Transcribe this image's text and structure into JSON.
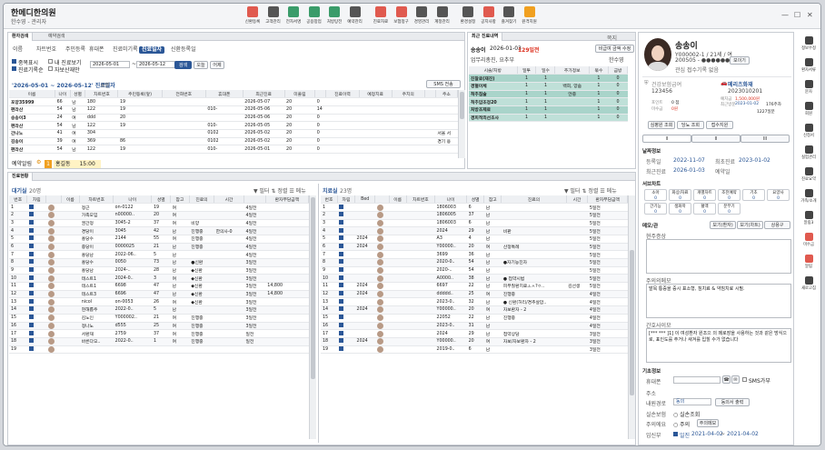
{
  "app": {
    "title": "한메디한의원",
    "subtitle": "한수영 - 관리자"
  },
  "toolbar": [
    {
      "label": "신환등록",
      "color": "#e05a4f"
    },
    {
      "label": "고객관리",
      "color": "#555"
    },
    {
      "label": "전자서명",
      "color": "#3a9c6a"
    },
    {
      "label": "공용창업",
      "color": "#3a9c6a"
    },
    {
      "label": "처방탕전",
      "color": "#3a9c6a"
    },
    {
      "label": "예약관리",
      "color": "#555"
    },
    {
      "label": "진료자료",
      "color": "#e05a4f"
    },
    {
      "label": "보험청구",
      "color": "#e05a4f"
    },
    {
      "label": "경영관리",
      "color": "#555"
    },
    {
      "label": "계정관리",
      "color": "#555"
    },
    {
      "label": "환경설정",
      "color": "#555"
    },
    {
      "label": "공지사항",
      "color": "#e05a4f"
    },
    {
      "label": "즐겨찾기",
      "color": "#555"
    },
    {
      "label": "원격지원",
      "color": "#f0a020"
    }
  ],
  "search_panel": {
    "tabs": [
      "환자검색",
      "예약검색"
    ],
    "subtabs": [
      "이름",
      "차트번호",
      "주민등록",
      "휴대폰",
      "진료미기록",
      "진료일자",
      "신환등록일"
    ],
    "active_subtab": "진료일자",
    "checks": [
      "중복표시",
      "진료기록순",
      "내 진료보기",
      "자보산재만"
    ],
    "date_from": "2026-05-01",
    "date_to": "2026-05-12",
    "btn_search": "검색",
    "btn_today": "오늘",
    "btn_yesterday": "어제",
    "result_title": "'2026-05-01 ~ 2026-05-12' 진료일자",
    "result_count": "8명",
    "sms": "SMS 전송",
    "columns": [
      "이름",
      "나이",
      "성별",
      "차트번호",
      "주민등록(앞)",
      "전화번호",
      "휴대폰",
      "최근진료",
      "미풀림",
      "",
      "진료이력",
      "예정치료",
      "주치의",
      "",
      "주소"
    ],
    "rows": [
      [
        "포양35999",
        "66",
        "남",
        "180",
        "19",
        "",
        "",
        "2026-05-07",
        "20",
        "0",
        "",
        "",
        "",
        "",
        ""
      ],
      [
        "편라산",
        "54",
        "남",
        "122",
        "19",
        "",
        "010-",
        "2026-05-06",
        "20",
        "14",
        "",
        "",
        "",
        "",
        ""
      ],
      [
        "송송이3",
        "24",
        "여",
        "ddd",
        "20",
        "",
        "",
        "2026-05-06",
        "20",
        "0",
        "",
        "",
        "",
        "",
        ""
      ],
      [
        "편라산",
        "54",
        "남",
        "122",
        "19",
        "",
        "010-",
        "2026-05-05",
        "20",
        "0",
        "",
        "",
        "",
        "",
        ""
      ],
      [
        "간나노",
        "41",
        "여",
        "304",
        "",
        "",
        "0102",
        "2026-05-02",
        "20",
        "0",
        "",
        "",
        "",
        "",
        "서울 서"
      ],
      [
        "김송이",
        "39",
        "여",
        "369",
        "86",
        "",
        "0102",
        "2026-05-02",
        "20",
        "0",
        "",
        "",
        "",
        "",
        "경기 용"
      ],
      [
        "편라산",
        "54",
        "남",
        "122",
        "19",
        "",
        "010-",
        "2026-05-01",
        "20",
        "0",
        "",
        "",
        "",
        "",
        ""
      ]
    ],
    "reservation_label": "예약알림",
    "reservation_badge": "1",
    "reservation_name": "홍길동",
    "reservation_time": "15:00"
  },
  "recent": {
    "title": "최근 진료내역",
    "close": "쪽지",
    "patient": "송송이",
    "date": "2026-01-03",
    "days_ago": "129일전",
    "btn_price": "비급여 금액 수정",
    "doctor_note": "업무리총진, 요추부",
    "doctor": "한수영",
    "columns": [
      "시술/처방",
      "일투",
      "일수",
      "추가정보",
      "묶수",
      "금방"
    ],
    "rows": [
      [
        "진찰료(재진)",
        "1",
        "1",
        "",
        "1",
        "0"
      ],
      [
        "경혈이체",
        "1",
        "1",
        "백회, 양숨",
        "1",
        "0"
      ],
      [
        "척추침술",
        "1",
        "1",
        "얀중",
        "1",
        "0"
      ],
      [
        "척추압조정20",
        "1",
        "1",
        "",
        "1",
        "0"
      ],
      [
        "처방조제료",
        "1",
        "1",
        "",
        "1",
        "0"
      ],
      [
        "경피적외선조사",
        "1",
        "1",
        "",
        "1",
        "0"
      ]
    ]
  },
  "patient": {
    "name": "송송이",
    "info": "Y000002-1 / 21세 / 여",
    "chart": "200505 - ●●●●●●●",
    "btn_view": "보이기",
    "agree": "관심 접수기록 없음",
    "insurance": "건강보험급여",
    "ins_no": "123456",
    "mileage_title": "메리츠화재",
    "mileage_no": "2023010201",
    "points_label": "포인트",
    "points": "0 점",
    "deposit_label": "예치금",
    "deposit": "1,500,000원",
    "recent_label": "최근방문",
    "recent": "2023-01-02",
    "visits": "176주차",
    "unpaid_label": "미수금",
    "unpaid": "0원",
    "mileage_val": "1227일분",
    "btns": [
      "심평원 조회",
      "당뇨 조회",
      "접수지원"
    ],
    "tabs": [
      "I",
      "II",
      "III"
    ],
    "visit_section": "날짜정보",
    "reg_label": "등록일",
    "reg": "2022-11-07",
    "first_label": "최초진료",
    "first": "2023-01-02",
    "last_label": "최근진료",
    "last": "2026-01-03",
    "resv_label": "예약일",
    "info_section": "서브차트",
    "chips": [
      "소아",
      "비교",
      "흡입",
      "맨드",
      "주의",
      "돌봄",
      "원외",
      "교통",
      "반송",
      "산재",
      "자보",
      "골다공"
    ],
    "chip_rows": [
      [
        "소아",
        "화상/차료",
        "개별차트",
        "조진예약",
        "기초",
        "요양사"
      ],
      [
        "간기능",
        "생화학",
        "혈액",
        "분무기"
      ]
    ],
    "memo_section": "메모/관",
    "memo_tabs": [
      "보기(환자)",
      "보기(차트)",
      "상용구"
    ],
    "memo1_label": "현주증상",
    "memo2_label": "주의의메모",
    "memo2": "발목 통증을 증시 표소형, 침치료 & 약침치료 시필.",
    "memo3_label": "간호사이모",
    "memo3": "[*** *** ]1] 이 여성환자 원조으 의 메로장을 사용하는 것과 같은 방식으로, 표인도를 주거나 새겨를 입힐 수가 없습니다",
    "basic_section": "기초정보",
    "phone_label": "휴대폰",
    "sms_label": "SMS가부",
    "addr_label": "주소",
    "route_label": "내원경로",
    "route": "동의",
    "btn_route": "동의서 출력",
    "cat_label": "실손보험",
    "cat_opt": "실손조회",
    "nurse_label": "주의에요",
    "nurse_opt": "주의",
    "nurse_btn": "주의메모",
    "period_label": "임신부",
    "period_from": "2021-04-02",
    "period_to": "2021-04-02"
  },
  "waiting": {
    "title": "진료현황",
    "left_title": "대기실",
    "left_count": "20명",
    "filters": [
      "필터",
      "정렬",
      "메뉴"
    ],
    "columns": [
      "번호",
      "차림",
      "",
      "이름",
      "차트번호",
      "나이",
      "성별",
      "참고",
      "진료의",
      "시간",
      "",
      "환자부담금액"
    ],
    "rows": [
      [
        "1",
        "",
        "",
        "정근",
        "on-0122",
        "19",
        "여",
        "",
        "",
        "4일전",
        ""
      ],
      [
        "2",
        "",
        "",
        "가족모임",
        "n00000..",
        "20",
        "여",
        "",
        "",
        "4일전",
        ""
      ],
      [
        "3",
        "",
        "",
        "권간정",
        "3045-2",
        "37",
        "여",
        "비양",
        "",
        "4일전",
        ""
      ],
      [
        "4",
        "",
        "",
        "경당이",
        "3045",
        "42",
        "남",
        "진행중",
        "한의사-0",
        "4일전",
        ""
      ],
      [
        "5",
        "",
        "",
        "홍당수",
        "2144",
        "55",
        "여",
        "진행중",
        "",
        "4일전",
        ""
      ],
      [
        "6",
        "",
        "",
        "중당이",
        "0000025",
        "21",
        "남",
        "진행중",
        "",
        "4일전",
        ""
      ],
      [
        "7",
        "",
        "",
        "홍당남",
        "2022-06..",
        "5",
        "남",
        "",
        "",
        "4일전",
        ""
      ],
      [
        "8",
        "",
        "",
        "홍당수",
        "0050",
        "73",
        "남",
        "●신환",
        "",
        "3일전",
        ""
      ],
      [
        "9",
        "",
        "",
        "홍당남",
        "2024-..",
        "28",
        "남",
        "◆신환",
        "",
        "3일전",
        ""
      ],
      [
        "10",
        "",
        "",
        "테스트1",
        "2024-0..",
        "3",
        "여",
        "◆신환",
        "",
        "3일전",
        ""
      ],
      [
        "11",
        "",
        "",
        "테스트1",
        "6698",
        "47",
        "남",
        "◆신환",
        "",
        "3일전",
        "14,800"
      ],
      [
        "12",
        "",
        "",
        "테스트3",
        "6696",
        "47",
        "남",
        "◆신환",
        "",
        "3일전",
        "14,800"
      ],
      [
        "13",
        "",
        "",
        "nicol",
        "on-0053",
        "26",
        "여",
        "◆신환",
        "",
        "3일전",
        ""
      ],
      [
        "14",
        "",
        "",
        "현해롭주",
        "2022-0..",
        "5",
        "남",
        "",
        "",
        "3일전",
        ""
      ],
      [
        "15",
        "",
        "",
        "김노인",
        "Y000002..",
        "21",
        "여",
        "진행중",
        "",
        "3일전",
        ""
      ],
      [
        "16",
        "",
        "",
        "정나노",
        "d555",
        "25",
        "여",
        "진행중",
        "",
        "3일전",
        ""
      ],
      [
        "17",
        "",
        "",
        "서환재",
        "2759",
        "37",
        "여",
        "진행중",
        "",
        "일전",
        ""
      ],
      [
        "18",
        "",
        "",
        "바른다모..",
        "2022-0..",
        "1",
        "여",
        "진행중",
        "",
        "일전",
        ""
      ],
      [
        "19",
        "",
        "",
        "",
        "",
        "",
        "",
        "",
        "",
        "",
        ""
      ]
    ],
    "right_title": "치료실",
    "right_count": "23명",
    "right_columns": [
      "번호",
      "차림",
      "Bed",
      "",
      "이름",
      "차트번호",
      "나이",
      "성별",
      "참고",
      "진료의",
      "시간",
      "환자부담금액"
    ],
    "right_rows": [
      [
        "1",
        "",
        "",
        "",
        "",
        "1806003",
        "6",
        "남",
        "",
        "",
        "5일전",
        ""
      ],
      [
        "2",
        "",
        "",
        "",
        "",
        "1806005",
        "37",
        "남",
        "",
        "",
        "5일전",
        ""
      ],
      [
        "3",
        "",
        "",
        "",
        "",
        "1806003",
        "6",
        "남",
        "",
        "",
        "5일전",
        ""
      ],
      [
        "4",
        "",
        "",
        "",
        "",
        "2024",
        "29",
        "남",
        "비판",
        "",
        "5일전",
        ""
      ],
      [
        "5",
        "",
        "2024",
        "",
        "",
        "A3",
        "4",
        "남",
        "",
        "",
        "5일전",
        ""
      ],
      [
        "6",
        "",
        "2024",
        "",
        "",
        "Y00000..",
        "20",
        "여",
        "산정특례",
        "",
        "5일전",
        "1,800"
      ],
      [
        "7",
        "",
        "",
        "",
        "",
        "3699",
        "36",
        "남",
        "",
        "",
        "5일전",
        ""
      ],
      [
        "8",
        "",
        "",
        "",
        "",
        "2020-0..",
        "54",
        "남",
        "●자기능진자",
        "",
        "5일전",
        ""
      ],
      [
        "9",
        "",
        "",
        "",
        "",
        "2020-..",
        "54",
        "남",
        "",
        "",
        "5일전",
        ""
      ],
      [
        "10",
        "",
        "",
        "",
        "",
        "A0000..",
        "38",
        "남",
        "● 첩약시범",
        "",
        "5일전",
        "136,500"
      ],
      [
        "11",
        "",
        "2024",
        "",
        "",
        "6697",
        "22",
        "남",
        "피부질환치료ㅗㅅ?ㅇ..",
        "김선생",
        "5일전",
        "209,700"
      ],
      [
        "12",
        "",
        "2024",
        "",
        "",
        "ddddd..",
        "25",
        "여",
        "진행중",
        "",
        "4일전",
        "1,800"
      ],
      [
        "13",
        "",
        "",
        "",
        "",
        "2023-0..",
        "32",
        "남",
        "● 신환(허리/경추살압..",
        "",
        "4일전",
        ""
      ],
      [
        "14",
        "",
        "2024",
        "",
        "",
        "Y00000..",
        "20",
        "여",
        "자보환자 - 2",
        "",
        "4일전",
        "1,800"
      ],
      [
        "15",
        "",
        "",
        "",
        "",
        "22052",
        "22",
        "남",
        "진행중",
        "",
        "4일전",
        ""
      ],
      [
        "16",
        "",
        "",
        "",
        "",
        "2023-0..",
        "31",
        "남",
        "",
        "",
        "4일전",
        ""
      ],
      [
        "17",
        "",
        "",
        "",
        "",
        "2024",
        "29",
        "남",
        "첩약상담",
        "",
        "3일전",
        ""
      ],
      [
        "18",
        "",
        "2024",
        "",
        "",
        "Y00000..",
        "20",
        "여",
        "자보/자보환자 - 2",
        "",
        "3일전",
        "1,800"
      ],
      [
        "19",
        "",
        "",
        "",
        "",
        "2019-0..",
        "6",
        "남",
        "",
        "",
        "3일전",
        ""
      ]
    ]
  },
  "rightside": [
    {
      "label": "정보수정"
    },
    {
      "label": "환자서류"
    },
    {
      "label": "문자"
    },
    {
      "label": "회원"
    },
    {
      "label": "신청서"
    },
    {
      "label": "실험관리"
    },
    {
      "label": "진료요약"
    },
    {
      "label": "가족/소개"
    },
    {
      "label": "알림3"
    },
    {
      "label": "미수금"
    },
    {
      "label": "알림"
    },
    {
      "label": "새로고침"
    }
  ]
}
